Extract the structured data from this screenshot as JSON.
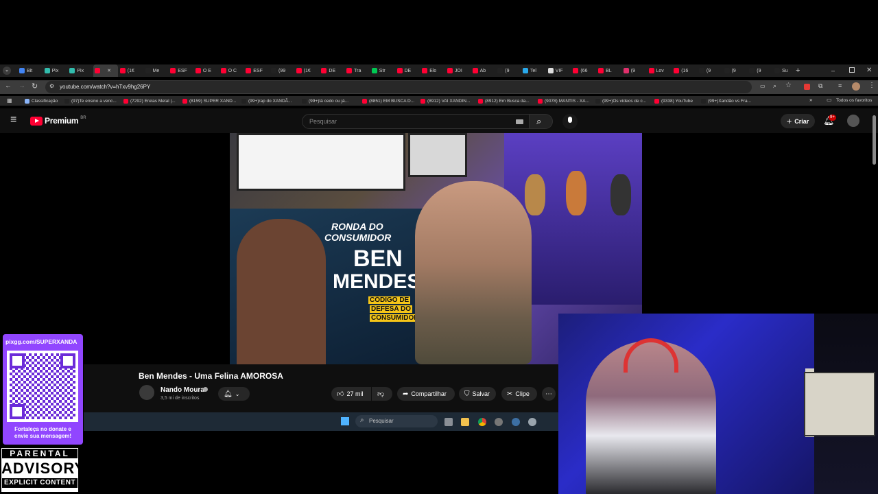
{
  "browser": {
    "tabs": [
      "Bit",
      "Pix",
      "Pix",
      "",
      "(1€",
      "Me",
      "ESF",
      "O E",
      "O C",
      "ESF",
      "(99",
      "(1€",
      "DE",
      "Tra",
      "Str",
      "DE",
      "Elo",
      "JOI",
      "Ab",
      "(9",
      "Tel",
      "VIF",
      "(66",
      "BL",
      "(9",
      "Lov",
      "(16",
      "(9",
      "(9",
      "(9",
      "Su"
    ],
    "address": "youtube.com/watch?v=hTxv9hg26PY",
    "bookmarks": [
      "Classificação",
      "(97)Te ensino a venc...",
      "(7292) Erelas Metal |...",
      "(8159) SUPER XAND...",
      "(99+)rap do XANDÃ...",
      "(99+)tá cedo ou já...",
      "(8851) EM BUSCA D...",
      "(8912) VAI XANDIN...",
      "(8912) Em Busca da...",
      "(9078) MANTIS - XA...",
      "(99+)Os vídeos de c...",
      "(9338) YouTube",
      "(99+)Xandão vs Fra..."
    ],
    "all_bookmarks": "Todos os favoritos"
  },
  "youtube": {
    "logo": "Premium",
    "region": "BR",
    "search_placeholder": "Pesquisar",
    "create_label": "Criar",
    "notif_badge": "9+",
    "video_title": "Ben Mendes - Uma Felina AMOROSA",
    "channel_name": "Nando Moura",
    "subscribers": "3,5 mi de inscritos",
    "likes": "27 mil",
    "share_label": "Compartilhar",
    "save_label": "Salvar",
    "clip_label": "Clipe",
    "thumb_line1": "RONDA DO",
    "thumb_line2": "CONSUMIDOR",
    "thumb_line3": "BEN",
    "thumb_line4": "MENDES",
    "thumb_line5": "CÓDIGO DE",
    "thumb_line6": "DEFESA DO",
    "thumb_line7": "CONSUMIDOR"
  },
  "taskbar": {
    "search_placeholder": "Pesquisar"
  },
  "overlay": {
    "pix_url": "pixgg.com/SUPERXANDA",
    "pix_message": "Fortaleça no donate e envie sua mensagem!",
    "advisory_line1": "PARENTAL",
    "advisory_line2": "ADVISORY",
    "advisory_line3": "EXPLICIT CONTENT"
  },
  "colors": {
    "yt_red": "#ff0033",
    "pix_purple": "#9146ff",
    "webcam_blue": "#2a2cc8"
  }
}
